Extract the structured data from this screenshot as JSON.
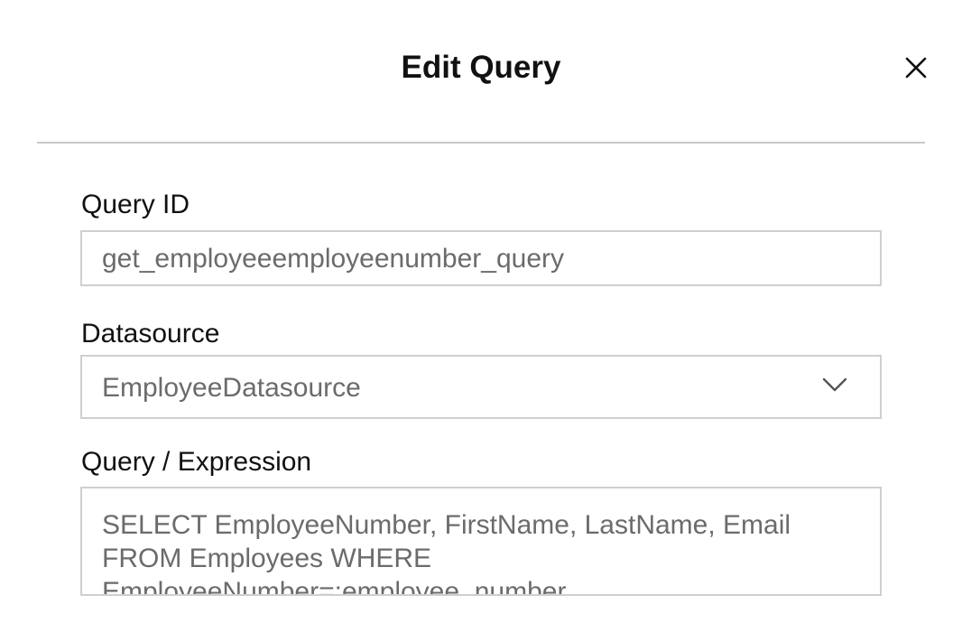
{
  "dialog": {
    "title": "Edit Query",
    "close_icon": "close-icon"
  },
  "form": {
    "query_id": {
      "label": "Query ID",
      "value": "get_employeeemployeenumber_query"
    },
    "datasource": {
      "label": "Datasource",
      "selected": "EmployeeDatasource",
      "icon": "chevron-down-icon"
    },
    "expression": {
      "label": "Query / Expression",
      "value": "SELECT EmployeeNumber, FirstName, LastName, Email FROM Employees WHERE EmployeeNumber=:employee_number"
    }
  }
}
